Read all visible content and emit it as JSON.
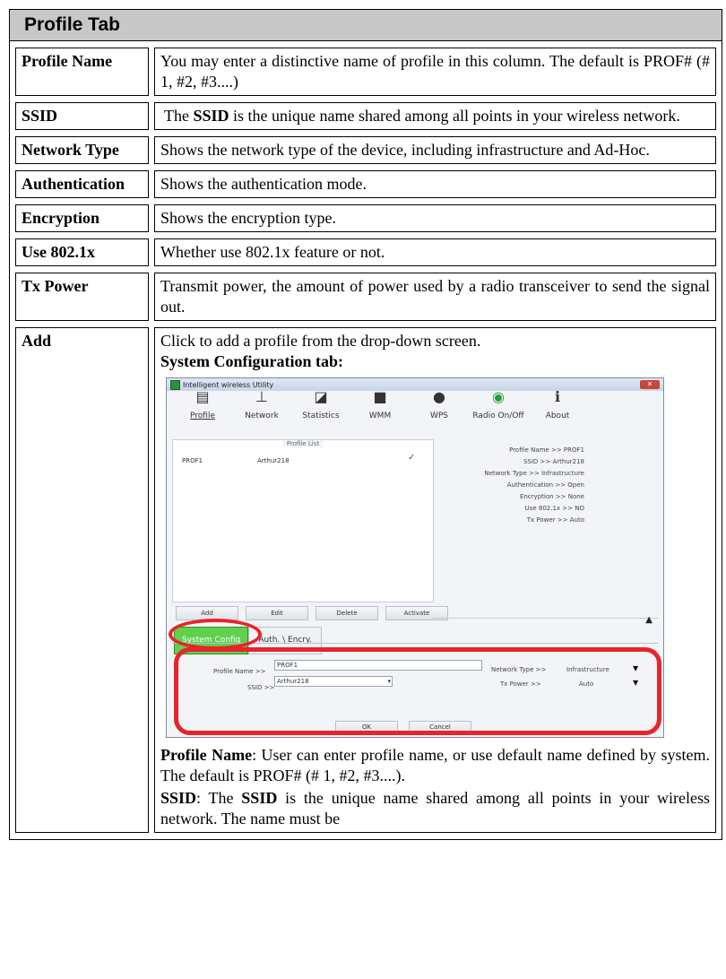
{
  "section_title": "Profile Tab",
  "rows": [
    {
      "key": "Profile Name",
      "val": "You may enter a distinctive name of profile in this column. The default is PROF# (# 1, #2, #3....)"
    },
    {
      "key": "SSID",
      "val_pre": "The ",
      "val_bold": "SSID",
      "val_post": " is the unique name shared among all points in your wireless network."
    },
    {
      "key": "Network Type",
      "val": "Shows the network type of the device, including infrastructure and Ad-Hoc."
    },
    {
      "key": "Authentication",
      "val": "Shows the authentication mode."
    },
    {
      "key": "Encryption",
      "val": "Shows the encryption type."
    },
    {
      "key": "Use 802.1x",
      "val": "Whether use 802.1x feature or not."
    },
    {
      "key": "Tx Power",
      "val": "Transmit power, the amount of power used by a radio transceiver to send the signal out."
    }
  ],
  "add": {
    "key": "Add",
    "intro": "Click to add a profile from the drop-down screen.",
    "subheading": "System Configuration tab:",
    "p1_bold": "Profile Name",
    "p1_text": ": User can enter profile name, or use default name defined by system. The default is PROF# (# 1, #2, #3....).",
    "p2_bold1": "SSID",
    "p2_text1": ": The ",
    "p2_bold2": "SSID",
    "p2_text2": " is the unique name shared among all points in your wireless network. The name must be"
  },
  "screenshot": {
    "window_title": "Intelligent wireless Utility",
    "toolbar": [
      {
        "label": "Profile",
        "icon": "profile-icon"
      },
      {
        "label": "Network",
        "icon": "network-icon"
      },
      {
        "label": "Statistics",
        "icon": "statistics-icon"
      },
      {
        "label": "WMM",
        "icon": "wmm-icon"
      },
      {
        "label": "WPS",
        "icon": "wps-icon"
      },
      {
        "label": "Radio On/Off",
        "icon": "radio-icon"
      },
      {
        "label": "About",
        "icon": "about-icon"
      }
    ],
    "profile_list_title": "Profile List",
    "profile_row": {
      "name": "PROF1",
      "ssid": "Arthur218"
    },
    "info": [
      "Profile Name >> PROF1",
      "SSID >> Arthur218",
      "Network Type >> Infrastructure",
      "Authentication >> Open",
      "Encryption >> None",
      "Use 802.1x >> NO",
      "Tx Power >> Auto"
    ],
    "buttons": [
      "Add",
      "Edit",
      "Delete",
      "Activate"
    ],
    "tabs": [
      "System Config",
      "Auth. \\ Encry."
    ],
    "form": {
      "profile_name_label": "Profile Name >>",
      "profile_name_value": "PROF1",
      "ssid_label": "SSID >>",
      "ssid_value": "Arthur218",
      "network_type_label": "Network Type >>",
      "network_type_value": "Infrastructure",
      "tx_power_label": "Tx Power >>",
      "tx_power_value": "Auto"
    },
    "ok": "OK",
    "cancel": "Cancel"
  }
}
